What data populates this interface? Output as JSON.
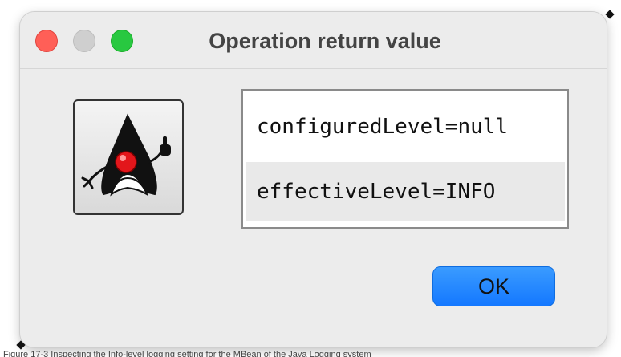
{
  "window": {
    "title": "Operation return value"
  },
  "result": {
    "rows": [
      "configuredLevel=null",
      "effectiveLevel=INFO"
    ]
  },
  "buttons": {
    "ok_label": "OK"
  },
  "caption": "Figure 17-3 Inspecting the Info-level logging setting for the MBean of the Java Logging system",
  "icon": {
    "name": "java-duke-icon"
  },
  "colors": {
    "close": "#ff5f57",
    "minimize": "#cfcfcf",
    "maximize": "#28c840",
    "accent_button": "#1478ff",
    "dialog_background": "#ececec"
  }
}
